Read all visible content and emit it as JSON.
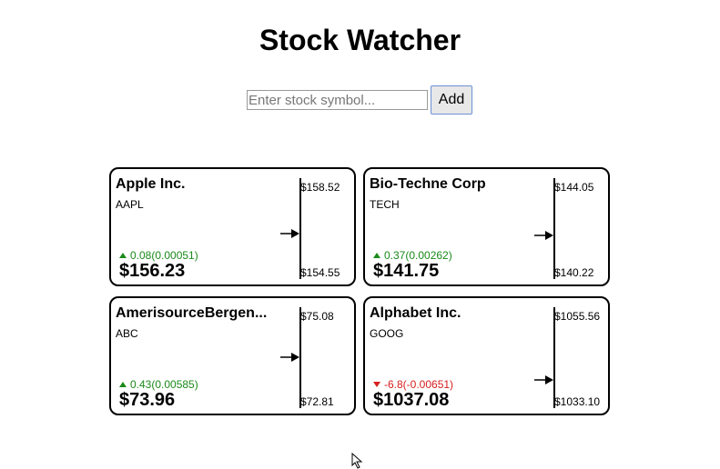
{
  "app": {
    "title": "Stock Watcher"
  },
  "add_form": {
    "placeholder": "Enter stock symbol...",
    "button_label": "Add"
  },
  "colors": {
    "positive": "#1a8a1a",
    "negative": "#d81e1e"
  },
  "stocks": [
    {
      "name": "Apple Inc.",
      "symbol": "AAPL",
      "change": "0.08(0.00051)",
      "direction": "up",
      "price": "$156.23",
      "high": "$158.52",
      "low": "$154.55",
      "price_value": 156.23,
      "high_value": 158.52,
      "low_value": 154.55
    },
    {
      "name": "Bio-Techne Corp",
      "symbol": "TECH",
      "change": "0.37(0.00262)",
      "direction": "up",
      "price": "$141.75",
      "high": "$144.05",
      "low": "$140.22",
      "price_value": 141.75,
      "high_value": 144.05,
      "low_value": 140.22
    },
    {
      "name": "AmerisourceBergen...",
      "symbol": "ABC",
      "change": "0.43(0.00585)",
      "direction": "up",
      "price": "$73.96",
      "high": "$75.08",
      "low": "$72.81",
      "price_value": 73.96,
      "high_value": 75.08,
      "low_value": 72.81
    },
    {
      "name": "Alphabet Inc.",
      "symbol": "GOOG",
      "change": "-6.8(-0.00651)",
      "direction": "down",
      "price": "$1037.08",
      "high": "$1055.56",
      "low": "$1033.10",
      "price_value": 1037.08,
      "high_value": 1055.56,
      "low_value": 1033.1
    }
  ]
}
